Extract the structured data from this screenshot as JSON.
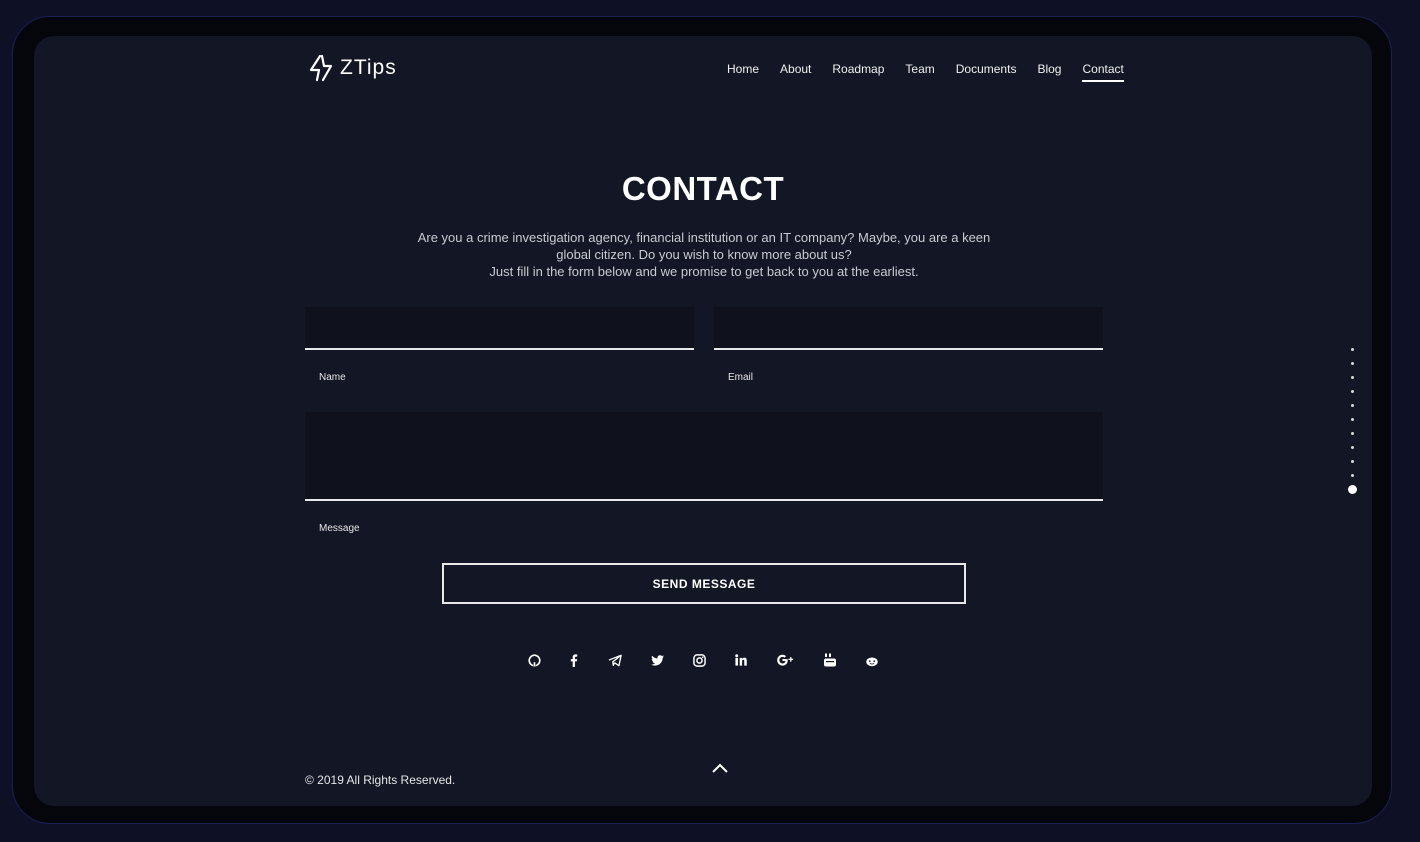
{
  "brand": {
    "name": "ZTips"
  },
  "nav": {
    "items": [
      {
        "label": "Home"
      },
      {
        "label": "About"
      },
      {
        "label": "Roadmap"
      },
      {
        "label": "Team"
      },
      {
        "label": "Documents"
      },
      {
        "label": "Blog"
      },
      {
        "label": "Contact",
        "active": true
      }
    ]
  },
  "contact": {
    "title": "CONTACT",
    "intro_line1": "Are you a crime investigation agency, financial institution or an IT company? Maybe, you are a keen global citizen. Do you wish to know more about us?",
    "intro_line2": "Just fill in the form below and we promise to get back to you at the earliest.",
    "form": {
      "name_label": "Name",
      "name_value": "",
      "email_label": "Email",
      "email_value": "",
      "message_label": "Message",
      "message_value": "",
      "submit_label": "SEND MESSAGE"
    }
  },
  "social": {
    "icons": [
      "github-icon",
      "facebook-icon",
      "telegram-icon",
      "twitter-icon",
      "instagram-icon",
      "linkedin-icon",
      "google-plus-icon",
      "youtube-icon",
      "reddit-icon"
    ]
  },
  "footer": {
    "copyright": "© 2019 All Rights Reserved."
  },
  "section_nav": {
    "count": 11,
    "active_index": 10
  },
  "colors": {
    "background": "#131624",
    "field_bg": "#0f111c",
    "text": "#ffffff",
    "muted_text": "#c9cbd3"
  }
}
